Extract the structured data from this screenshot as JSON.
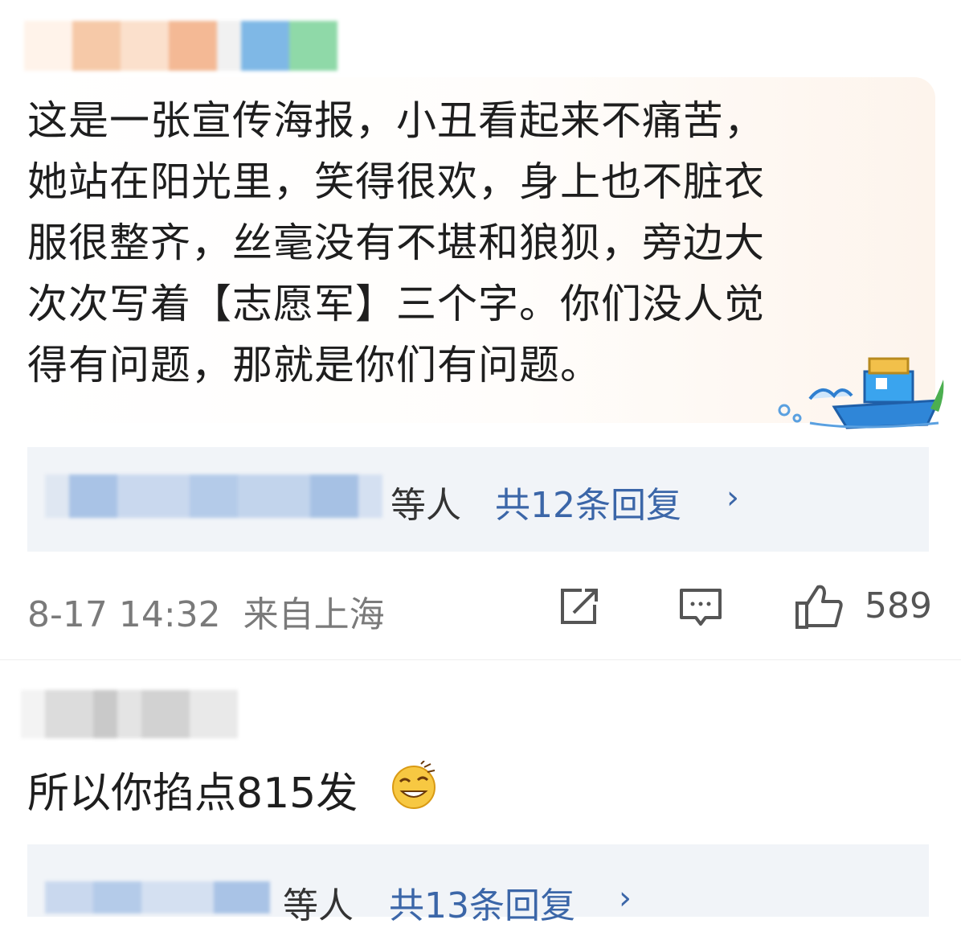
{
  "comments": [
    {
      "text": "这是一张宣传海报，小丑看起来不痛苦，\n她站在阳光里，笑得很欢，身上也不脏衣\n服很整齐，丝毫没有不堪和狼狈，旁边大\n次次写着【志愿军】三个字。你们没人觉\n得有问题，那就是你们有问题。",
      "reply_suffix": "等人",
      "reply_count": "共12条回复",
      "reply_arrow": "›",
      "timestamp": "8-17 14:32",
      "location": "来自上海",
      "likes": "589",
      "icons": [
        "share-icon",
        "comment-icon",
        "like-icon",
        "boat-sticker-icon"
      ]
    },
    {
      "text": "所以你掐点815发",
      "emoji": "grin-emoji",
      "reply_suffix": "等人",
      "reply_count": "共13条回复",
      "reply_arrow": "›"
    }
  ],
  "colors": {
    "link": "#3b66a8",
    "reply_bg": "#f1f4f8",
    "meta_text": "#7a7a7a"
  }
}
